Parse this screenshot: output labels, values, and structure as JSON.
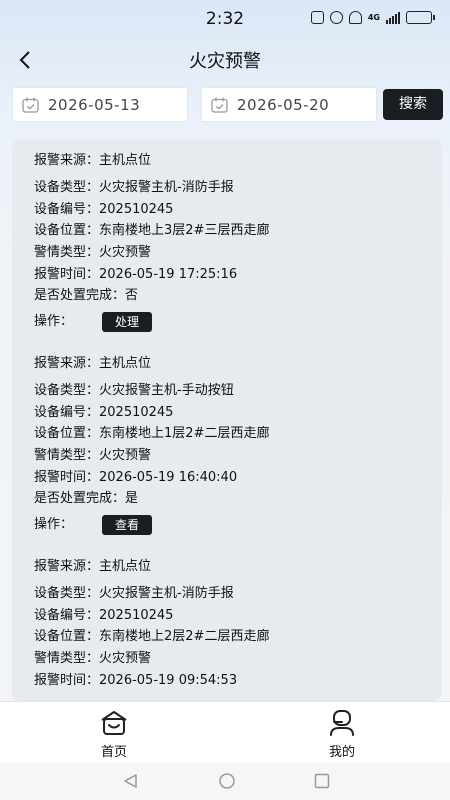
{
  "status": {
    "time": "2:32",
    "network": "4G"
  },
  "nav": {
    "title": "火灾预警"
  },
  "filter": {
    "start_date": "2026-05-13",
    "end_date": "2026-05-20",
    "search_label": "搜索"
  },
  "labels": {
    "source": "报警来源：",
    "type": "设备类型：",
    "code": "设备编号：",
    "location": "设备位置：",
    "category": "警情类型：",
    "time": "报警时间：",
    "handled": "是否处置完成：",
    "action": "操作："
  },
  "records": [
    {
      "source": "主机点位",
      "type": "火灾报警主机-消防手报",
      "code": "202510245",
      "location": "东南楼地上3层2#三层西走廊",
      "category": "火灾预警",
      "time": "2026-05-19 17:25:16",
      "handled": "否",
      "action": "处理"
    },
    {
      "source": "主机点位",
      "type": "火灾报警主机-手动按钮",
      "code": "202510245",
      "location": "东南楼地上1层2#二层西走廊",
      "category": "火灾预警",
      "time": "2026-05-19 16:40:40",
      "handled": "是",
      "action": "查看"
    },
    {
      "source": "主机点位",
      "type": "火灾报警主机-消防手报",
      "code": "202510245",
      "location": "东南楼地上2层2#二层西走廊",
      "category": "火灾预警",
      "time": "2026-05-19 09:54:53"
    }
  ],
  "tabbar": {
    "home": "首页",
    "mine": "我的"
  },
  "colors": {
    "button_dark": "#1a1d22",
    "header_bg": "#dbe7f6",
    "card_bg": "#e7eaef"
  }
}
